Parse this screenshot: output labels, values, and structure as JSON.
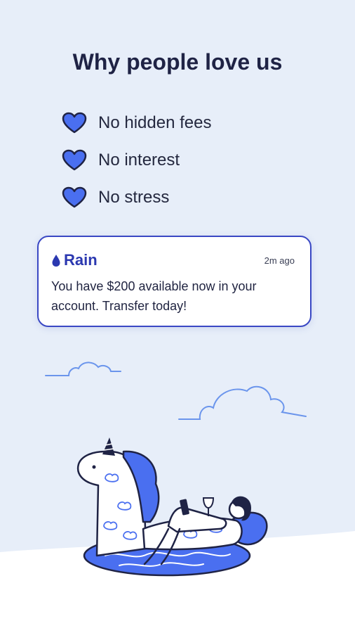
{
  "headline": "Why people love us",
  "benefits": [
    {
      "icon": "heart-icon",
      "label": "No hidden fees"
    },
    {
      "icon": "heart-icon",
      "label": "No interest"
    },
    {
      "icon": "heart-icon",
      "label": "No stress"
    }
  ],
  "notification": {
    "brand": "Rain",
    "time": "2m ago",
    "message": "You have $200 available now in your account. Transfer today!"
  },
  "colors": {
    "background": "#e7eef9",
    "accent": "#3a48c4",
    "heart_fill": "#4a6ff0",
    "floor": "#ffffff"
  }
}
